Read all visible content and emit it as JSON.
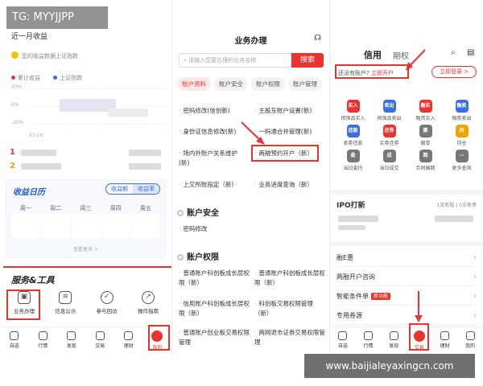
{
  "watermark": "TG: MYYJJPP",
  "site_url": "www.baijialeyaxingcn.com",
  "colors": {
    "accent": "#e8332f",
    "blue": "#1d5ad6"
  },
  "panel1": {
    "title": "近一月收益",
    "note": "您的收益数据上证指数",
    "legend": [
      "累计收益",
      "上证指数"
    ],
    "y_ticks": [
      "20%",
      "0%",
      "-20%"
    ],
    "x_tick": "03-16",
    "ranks": [
      "1",
      "2"
    ],
    "calendar": {
      "title": "收益日历",
      "toggle": [
        "收益额",
        "收益率"
      ],
      "days": [
        "周一",
        "周二",
        "周三",
        "周四",
        "周五"
      ],
      "more": "查看更多 >"
    },
    "section_title": "服务&工具",
    "tools": [
      {
        "label": "业务办理",
        "icon": "briefcase-icon"
      },
      {
        "label": "信息公示",
        "icon": "notice-icon"
      },
      {
        "label": "参与回访",
        "icon": "handshake-icon"
      },
      {
        "label": "操作指南",
        "icon": "compass-icon"
      }
    ],
    "tabbar": [
      {
        "label": "自选"
      },
      {
        "label": "行情"
      },
      {
        "label": "发现"
      },
      {
        "label": "交易"
      },
      {
        "label": "理财"
      },
      {
        "label": "我的"
      }
    ]
  },
  "panel2": {
    "title": "业务办理",
    "search_placeholder": "请输入您要办理的业务名称",
    "search_button": "搜索",
    "tabs": [
      "账户资料",
      "账户安全",
      "账户权限",
      "账户管理"
    ],
    "services": [
      "密码修改(信创新)",
      "主股东账户设置(新)",
      "身份证信息修改(新)",
      "一码通合并管理(新)",
      "场内外账户关系维护(新)",
      "两融预约开户（新）",
      "上交所账指定（新）",
      "业务进度查询（新）"
    ],
    "group_security": "账户安全",
    "security_item": "密码修改",
    "group_permissions": "账户权限",
    "permission_items": [
      "普通账户科创板成长层权限（新）",
      "普通账户科创板成长层权限（新）",
      "信用账户科创板成长层权限（新）",
      "科创板交易权限管理（新）",
      "普通账户创业板交易权限管理",
      "两网退市证券交易权限管理"
    ]
  },
  "panel3": {
    "tab_active": "信用",
    "tab_inactive": "期权",
    "account_question": "还没有账户?",
    "open_link": "立即开户",
    "login_button": "立即登录 >",
    "grid": [
      {
        "label": "担保品买入",
        "glyph": "买入",
        "color": "#e8332f"
      },
      {
        "label": "担保品卖出",
        "glyph": "卖出",
        "color": "#3c6ee0"
      },
      {
        "label": "融资买入",
        "glyph": "融买",
        "color": "#e8332f"
      },
      {
        "label": "融券卖出",
        "glyph": "融卖",
        "color": "#3c6ee0"
      },
      {
        "label": "卖券还款",
        "glyph": "还款",
        "color": "#3c6ee0"
      },
      {
        "label": "买券还券",
        "glyph": "还券",
        "color": "#e8332f"
      },
      {
        "label": "撤单",
        "glyph": "撤",
        "color": "#777777"
      },
      {
        "label": "持仓",
        "glyph": "持",
        "color": "#f0a400"
      },
      {
        "label": "当日委托",
        "glyph": "委",
        "color": "#777777"
      },
      {
        "label": "当日成交",
        "glyph": "成",
        "color": "#777777"
      },
      {
        "label": "合同展期",
        "glyph": "期",
        "color": "#777777"
      },
      {
        "label": "更多查询",
        "glyph": "⋯",
        "color": "#777777"
      }
    ],
    "ipo_title": "IPO打新",
    "ipo_meta": "1支新股 | 0支新债",
    "rows": [
      {
        "label": "融E惠"
      },
      {
        "label": "两融开户咨询"
      },
      {
        "label": "智能条件单",
        "badge": "新功能"
      },
      {
        "label": "专用券源"
      }
    ],
    "tabbar": [
      {
        "label": "自选"
      },
      {
        "label": "行情"
      },
      {
        "label": "发现"
      },
      {
        "label": "交易"
      },
      {
        "label": "理财"
      },
      {
        "label": "我的"
      }
    ]
  }
}
